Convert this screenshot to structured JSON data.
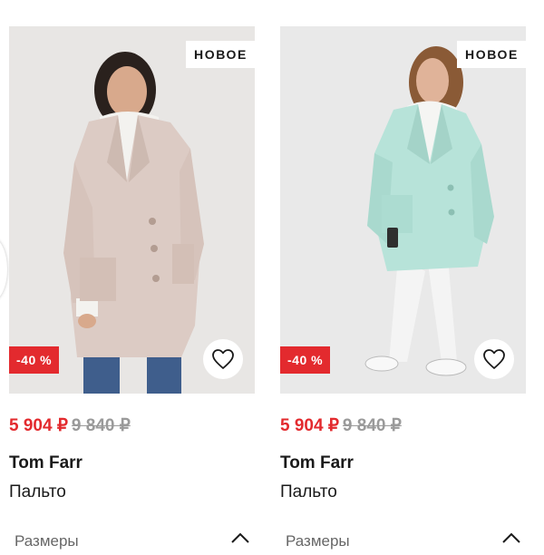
{
  "products": [
    {
      "badge_new": "НОВОЕ",
      "discount": "-40 %",
      "price_new": "5 904 ₽",
      "price_old": "9 840 ₽",
      "brand": "Tom Farr",
      "type": "Пальто",
      "sizes_label": "Размеры",
      "coat_color": "#dccbc4"
    },
    {
      "badge_new": "НОВОЕ",
      "discount": "-40 %",
      "price_new": "5 904 ₽",
      "price_old": "9 840 ₽",
      "brand": "Tom Farr",
      "type": "Пальто",
      "sizes_label": "Размеры",
      "coat_color": "#b7e3d9"
    }
  ],
  "colors": {
    "accent_red": "#e32a2e",
    "old_price_gray": "#9a9a9a",
    "photo_bg": "#e9e9e9"
  },
  "icons": [
    "heart-icon",
    "chevron-up-icon",
    "carousel-arrow"
  ]
}
